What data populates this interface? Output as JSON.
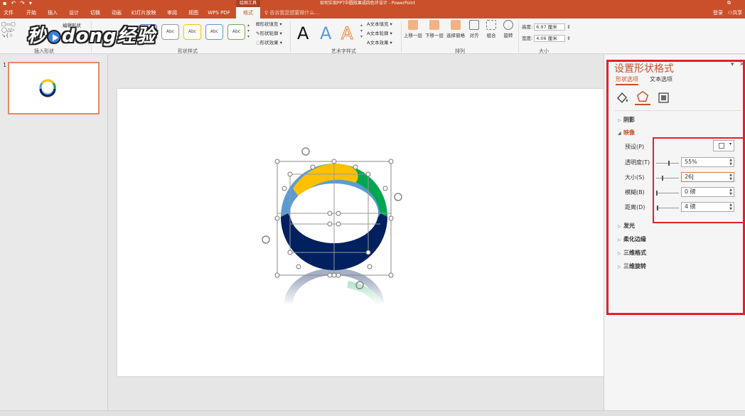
{
  "titlebar": {
    "context_tab": "绘图工具",
    "title": "如何实现PPT中圆效果成四色环设计 - PowerPoint"
  },
  "tabs": [
    {
      "label": "文件"
    },
    {
      "label": "开始"
    },
    {
      "label": "插入"
    },
    {
      "label": "设计"
    },
    {
      "label": "切换"
    },
    {
      "label": "动画"
    },
    {
      "label": "幻灯片放映"
    },
    {
      "label": "审阅"
    },
    {
      "label": "视图"
    },
    {
      "label": "WPS PDF"
    },
    {
      "label": "格式"
    }
  ],
  "search_placeholder": "告诉我您想要做什么...",
  "login": "登录",
  "share": "共享",
  "ribbon": {
    "insert_shapes": {
      "label": "插入形状",
      "edit_shape": "编辑形状"
    },
    "shape_styles": {
      "label": "形状样式",
      "thumbs": [
        "Abc",
        "Abc",
        "Abc",
        "Abc",
        "Abc"
      ],
      "fill": "形状填充",
      "outline": "形状轮廓",
      "effect": "形状效果"
    },
    "wordart": {
      "label": "艺术字样式",
      "letters": [
        "A",
        "A",
        "A"
      ],
      "fill": "文本填充",
      "outline": "文本轮廓",
      "effect": "文本效果"
    },
    "arrange": {
      "label": "排列",
      "buttons": [
        "上移一层",
        "下移一层",
        "选择窗格",
        "对齐",
        "组合",
        "旋转"
      ]
    },
    "size": {
      "label": "大小",
      "height_label": "高度:",
      "height": "6.97 厘米",
      "width_label": "宽度:",
      "width": "4.06 厘米"
    }
  },
  "watermark": {
    "part1": "秒",
    "part2": "dong经验"
  },
  "thumbnails": [
    {
      "number": "1"
    }
  ],
  "format_pane": {
    "title": "设置形状格式",
    "tab_shape": "形状选项",
    "tab_text": "文本选项",
    "sections": {
      "shadow": "阴影",
      "reflection": "映像",
      "glow": "发光",
      "soft_edges": "柔化边缘",
      "format_3d": "三维格式",
      "rotation_3d": "三维旋转"
    },
    "reflection": {
      "preset_label": "预设(P)",
      "transparency_label": "透明度(T)",
      "transparency_value": "55%",
      "transparency_level": 0.55,
      "size_label": "大小(S)",
      "size_value": "26",
      "size_level": 0.26,
      "blur_label": "模糊(B)",
      "blur_value": "0 磅",
      "blur_level": 0,
      "distance_label": "距离(D)",
      "distance_value": "4 磅",
      "distance_level": 0.04
    }
  },
  "colors": {
    "accent": "#c9502a",
    "ring_blue": "#5b9bd5",
    "ring_yellow": "#ffc000",
    "ring_green": "#00a651",
    "ring_navy": "#002060",
    "highlight_red": "#e0222a"
  }
}
